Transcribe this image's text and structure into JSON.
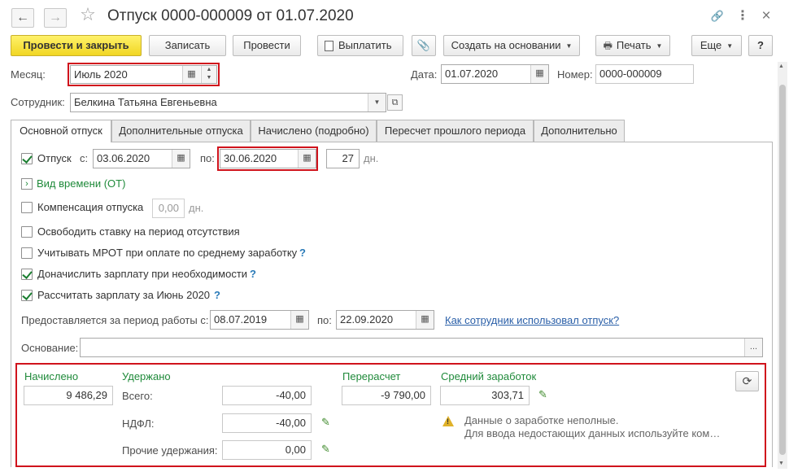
{
  "window": {
    "title": "Отпуск 0000-000009 от 01.07.2020",
    "back_icon": "←",
    "forward_icon": "→",
    "star_icon": "☆",
    "link_icon": "🔗",
    "menu_icon": "⋮",
    "close_icon": "×"
  },
  "toolbar": {
    "post_close": "Провести и закрыть",
    "save": "Записать",
    "post": "Провести",
    "pay": "Выплатить",
    "create_based": "Создать на основании",
    "print": "Печать",
    "more": "Еще",
    "help": "?"
  },
  "header": {
    "month_label": "Месяц:",
    "month_value": "Июль 2020",
    "date_label": "Дата:",
    "date_value": "01.07.2020",
    "number_label": "Номер:",
    "number_value": "0000-000009",
    "employee_label": "Сотрудник:",
    "employee_value": "Белкина Татьяна Евгеньевна"
  },
  "tabs": [
    {
      "label": "Основной отпуск",
      "active": true
    },
    {
      "label": "Дополнительные отпуска",
      "active": false
    },
    {
      "label": "Начислено (подробно)",
      "active": false
    },
    {
      "label": "Пересчет прошлого периода",
      "active": false
    },
    {
      "label": "Дополнительно",
      "active": false
    }
  ],
  "main": {
    "vacation_label": "Отпуск",
    "vacation_checked": true,
    "from_label": "с:",
    "from_value": "03.06.2020",
    "to_label": "по:",
    "to_value": "30.06.2020",
    "days_value": "27",
    "days_unit": "дн.",
    "time_kind": "Вид времени (ОТ)",
    "compensation_label": "Компенсация отпуска",
    "compensation_checked": false,
    "compensation_value": "0,00",
    "compensation_unit": "дн.",
    "free_rate_label": "Освободить ставку на период отсутствия",
    "free_rate_checked": false,
    "mrot_label": "Учитывать МРОТ при оплате по среднему заработку",
    "mrot_checked": false,
    "accrue_label": "Доначислить зарплату при необходимости",
    "accrue_checked": true,
    "calc_salary_label": "Рассчитать зарплату за Июнь 2020",
    "calc_salary_checked": true,
    "question_mark": "?",
    "period_label": "Предоставляется за период работы с:",
    "period_from": "08.07.2019",
    "period_to_label": "по:",
    "period_to": "22.09.2020",
    "usage_link": "Как сотрудник использовал отпуск?",
    "basis_label": "Основание:",
    "basis_value": "",
    "basis_button": "..."
  },
  "totals": {
    "accrued_label": "Начислено",
    "accrued_value": "9 486,29",
    "withheld_label": "Удержано",
    "total_label": "Всего:",
    "total_value": "-40,00",
    "ndfl_label": "НДФЛ:",
    "ndfl_value": "-40,00",
    "other_label": "Прочие удержания:",
    "other_value": "0,00",
    "recalc_label": "Перерасчет",
    "recalc_value": "-9 790,00",
    "avg_label": "Средний заработок",
    "avg_value": "303,71",
    "warning_line1": "Данные о заработке неполные.",
    "warning_line2": "Для ввода недостающих данных используйте ком…"
  },
  "colors": {
    "primary_button": "#f1d623",
    "highlight_border": "#d0131c",
    "group_title": "#1f8a3a",
    "link": "#2a5fa8"
  }
}
